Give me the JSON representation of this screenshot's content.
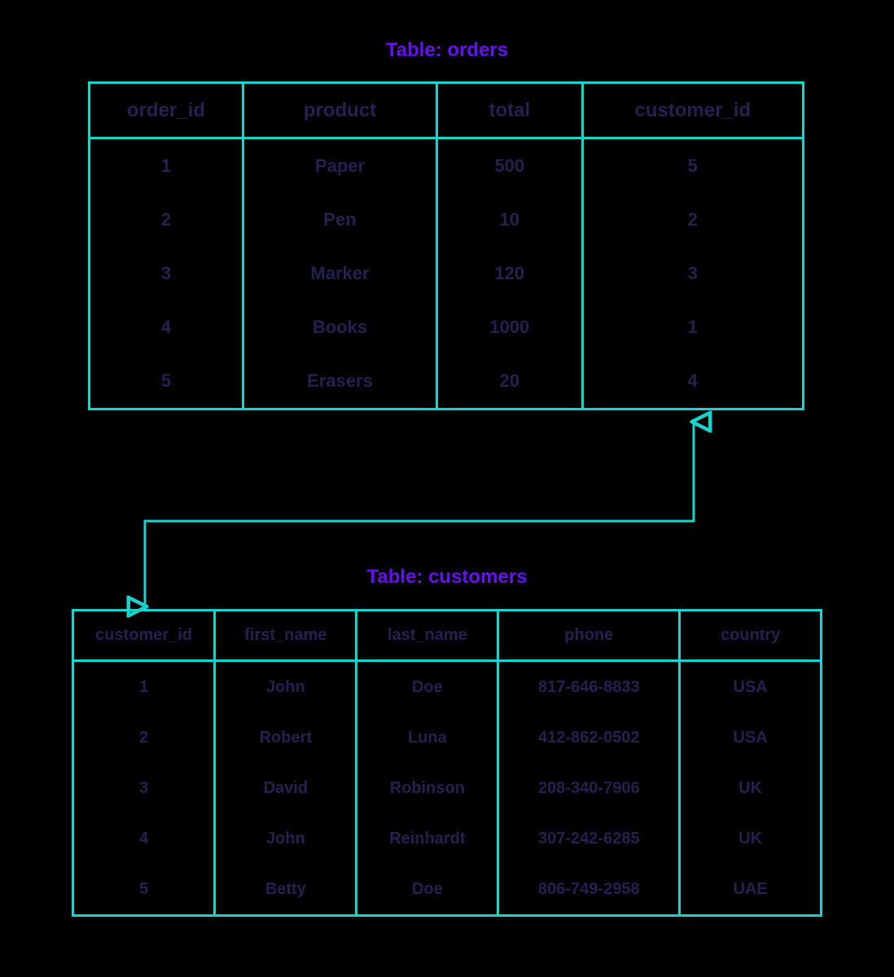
{
  "titles": {
    "orders": "Table: orders",
    "customers": "Table: customers"
  },
  "orders": {
    "headers": [
      "order_id",
      "product",
      "total",
      "customer_id"
    ],
    "rows": [
      {
        "order_id": "1",
        "product": "Paper",
        "total": "500",
        "customer_id": "5"
      },
      {
        "order_id": "2",
        "product": "Pen",
        "total": "10",
        "customer_id": "2"
      },
      {
        "order_id": "3",
        "product": "Marker",
        "total": "120",
        "customer_id": "3"
      },
      {
        "order_id": "4",
        "product": "Books",
        "total": "1000",
        "customer_id": "1"
      },
      {
        "order_id": "5",
        "product": "Erasers",
        "total": "20",
        "customer_id": "4"
      }
    ]
  },
  "customers": {
    "headers": [
      "customer_id",
      "first_name",
      "last_name",
      "phone",
      "country"
    ],
    "rows": [
      {
        "customer_id": "1",
        "first_name": "John",
        "last_name": "Doe",
        "phone": "817-646-8833",
        "country": "USA"
      },
      {
        "customer_id": "2",
        "first_name": "Robert",
        "last_name": "Luna",
        "phone": "412-862-0502",
        "country": "USA"
      },
      {
        "customer_id": "3",
        "first_name": "David",
        "last_name": "Robinson",
        "phone": "208-340-7906",
        "country": "UK"
      },
      {
        "customer_id": "4",
        "first_name": "John",
        "last_name": "Reinhardt",
        "phone": "307-242-6285",
        "country": "UK"
      },
      {
        "customer_id": "5",
        "first_name": "Betty",
        "last_name": "Doe",
        "phone": "806-749-2958",
        "country": "UAE"
      }
    ]
  },
  "config": {
    "border_color": "#17d4cd",
    "text_color": "#25204f",
    "title_color": "#6610f2",
    "link": {
      "from_table": "customers",
      "from_column": "customer_id",
      "to_table": "orders",
      "to_column": "customer_id"
    }
  }
}
